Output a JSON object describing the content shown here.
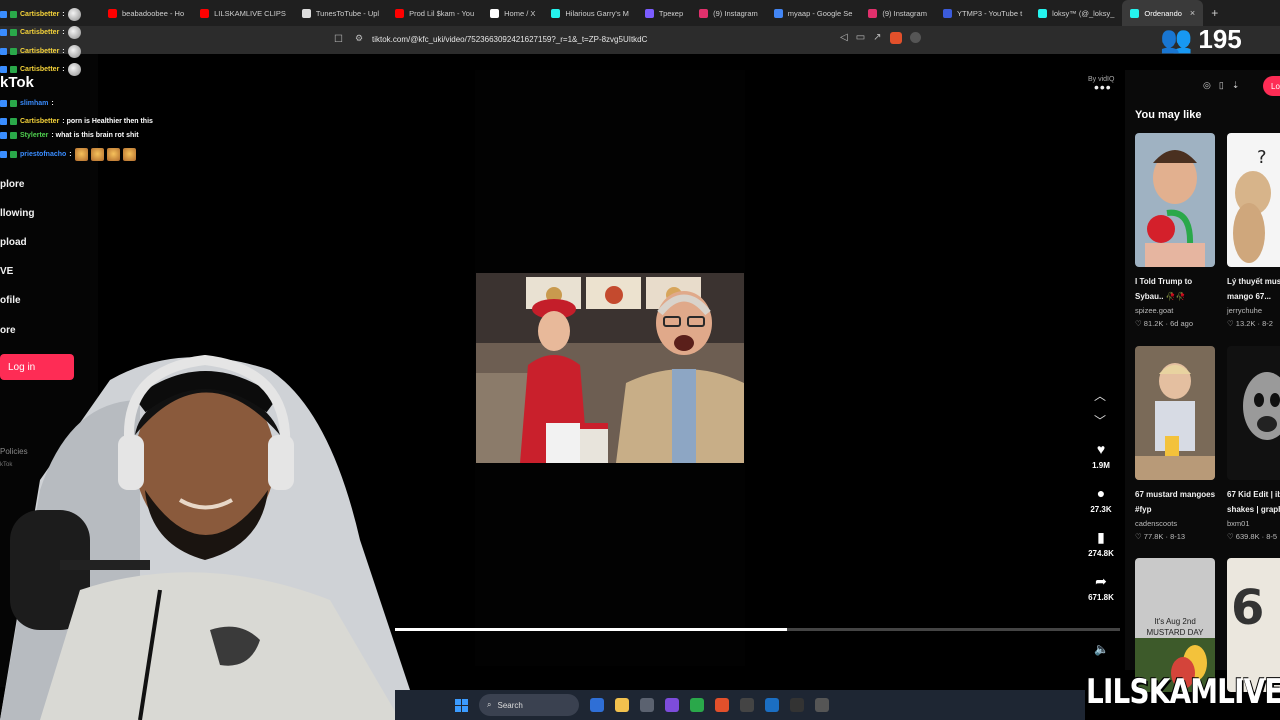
{
  "browser": {
    "tabs": [
      {
        "label": "beabadoobee - Ho",
        "icon_color": "#ff0000"
      },
      {
        "label": "LILSKAMLIVE CLIPS",
        "icon_color": "#ff0000"
      },
      {
        "label": "TunesToTube - Upl",
        "icon_color": "#dddddd"
      },
      {
        "label": "Prod Lil $kam - You",
        "icon_color": "#ff0000"
      },
      {
        "label": "Home / X",
        "icon_color": "#ffffff"
      },
      {
        "label": "Hilarious Garry's M",
        "icon_color": "#25f4ee"
      },
      {
        "label": "Трекер",
        "icon_color": "#7b5cff"
      },
      {
        "label": "(9) Instagram",
        "icon_color": "#e1306c"
      },
      {
        "label": "myaap - Google Se",
        "icon_color": "#4285f4"
      },
      {
        "label": "(9) Instagram",
        "icon_color": "#e1306c"
      },
      {
        "label": "YTMP3 - YouTube t",
        "icon_color": "#3b5bdb"
      },
      {
        "label": "loksy™ (@_loksy_",
        "icon_color": "#25f4ee"
      },
      {
        "label": "Ordenando",
        "icon_color": "#25f4ee",
        "active": true
      }
    ],
    "url": "tiktok.com/@kfc_uki/video/7523663092421627159?_r=1&_t=ZP-8zvg5UItkdC",
    "new_tab_label": "+"
  },
  "stream": {
    "viewer_count": "195",
    "watermark": "LILSKAMLIVE"
  },
  "chat": [
    {
      "user": "Cartisbetter",
      "message": ":",
      "color": "#f5d33a",
      "emote": "white"
    },
    {
      "user": "Cartisbetter",
      "message": ":",
      "color": "#f5d33a",
      "emote": "white"
    },
    {
      "user": "Cartisbetter",
      "message": ":",
      "color": "#f5d33a",
      "emote": "white"
    },
    {
      "user": "Cartisbetter",
      "message": ":",
      "color": "#f5d33a",
      "emote": "white"
    },
    {
      "user": "slimham",
      "message": ":",
      "color": "#3a8dff",
      "emote": "none"
    },
    {
      "user": "Cartisbetter",
      "message": ": porn is Healthier then this",
      "color": "#f5d33a",
      "emote": "none"
    },
    {
      "user": "Stylerter",
      "message": ": what is this brain rot shit",
      "color": "#4fd14f",
      "emote": "none"
    },
    {
      "user": "priestofnacho",
      "message": ":",
      "color": "#3a8dff",
      "emote": "gold"
    }
  ],
  "tiktok": {
    "logo": "kTok",
    "nav": [
      "plore",
      "llowing",
      "pload",
      "VE",
      "ofile",
      "ore"
    ],
    "login_label": "Log in",
    "policies_label": "Policies",
    "footer_label": "kTok",
    "vidiq_label": "By vidIQ",
    "actions": [
      {
        "icon": "heart-icon",
        "glyph": "♥",
        "count": "1.9M"
      },
      {
        "icon": "comment-icon",
        "glyph": "●",
        "count": "27.3K"
      },
      {
        "icon": "bookmark-icon",
        "glyph": "▮",
        "count": "274.8K"
      },
      {
        "icon": "share-icon",
        "glyph": "➦",
        "count": "671.8K"
      }
    ],
    "progress": 0.54,
    "top_login": "Lo",
    "you_may_like": "You may like",
    "recommendations": [
      {
        "title": "I Told Trump to",
        "title2": "Sybau.. 🥀🥀",
        "user": "spizee.goat",
        "stats": "♡ 81.2K · 6d ago",
        "thumb_color": "#8fa3b5"
      },
      {
        "title": "Lý thuyết mus",
        "title2": "mango 67...",
        "user": "jerrychuhe",
        "stats": "♡ 13.2K · 8-2",
        "thumb_color": "#f4f4f4"
      },
      {
        "title": "67 mustard mangoes",
        "title2": "#fyp",
        "user": "cadenscoots",
        "stats": "♡ 77.8K · 8-13",
        "thumb_color": "#6b4a2a"
      },
      {
        "title": "67 Kid Edit | ib",
        "title2": "shakes | graph",
        "user": "bxm01",
        "stats": "♡ 639.8K · 8-5",
        "thumb_color": "#202020"
      },
      {
        "title": "",
        "title2": "",
        "user": "",
        "stats": "",
        "thumb_color": "#c8c8c8",
        "overlay": "It's Aug 2nd MUSTARD DAY"
      },
      {
        "title": "",
        "title2": "",
        "user": "",
        "stats": "",
        "thumb_color": "#e8e4dc",
        "overlay": "6"
      }
    ]
  },
  "taskbar": {
    "search_label": "Search"
  }
}
